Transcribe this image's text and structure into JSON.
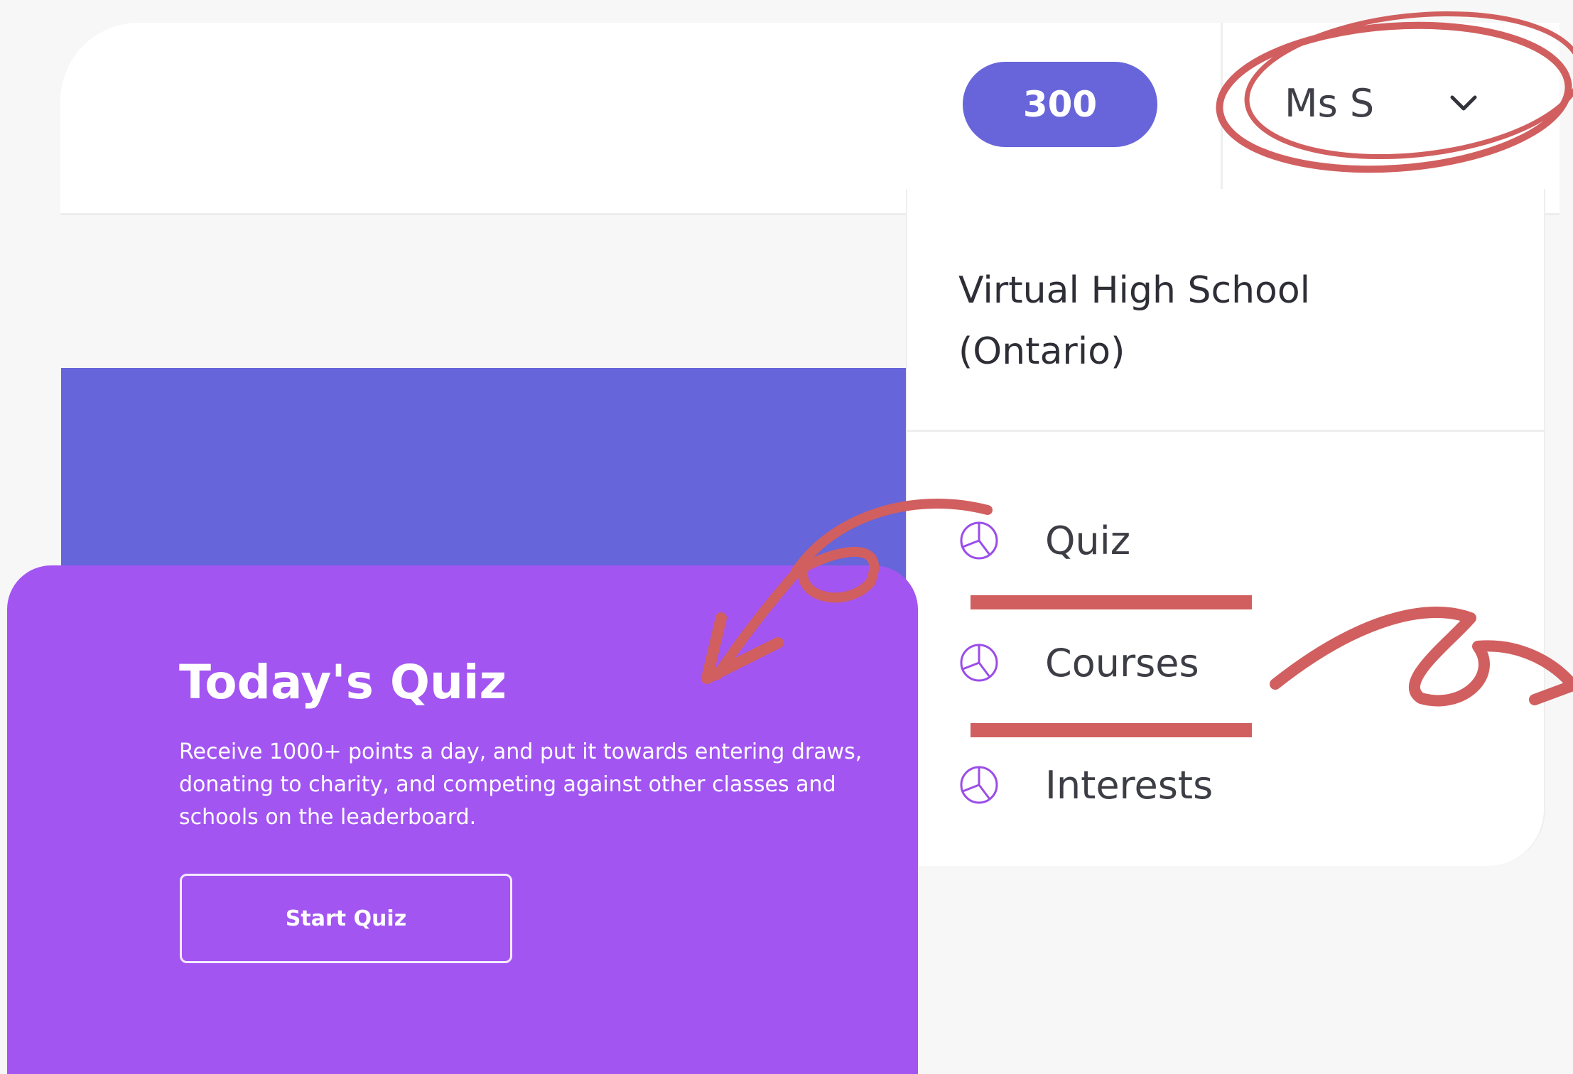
{
  "header": {
    "points": "300",
    "user_name": "Ms S"
  },
  "dropdown": {
    "school_name": "Virtual High School (Ontario)",
    "items": [
      {
        "label": "Quiz",
        "icon": "pie-chart-icon"
      },
      {
        "label": "Courses",
        "icon": "pie-chart-icon"
      },
      {
        "label": "Interests",
        "icon": "pie-chart-icon"
      }
    ]
  },
  "quiz_card": {
    "title": "Today's Quiz",
    "description": "Receive 1000+ points a day, and put it towards entering draws, donating to charity, and competing against other classes and schools on the leaderboard.",
    "button_label": "Start Quiz"
  },
  "colors": {
    "accent_blue": "#6665d9",
    "accent_purple": "#a255f1",
    "annotation_red": "#d15f5f",
    "icon_purple": "#9b4de8"
  }
}
